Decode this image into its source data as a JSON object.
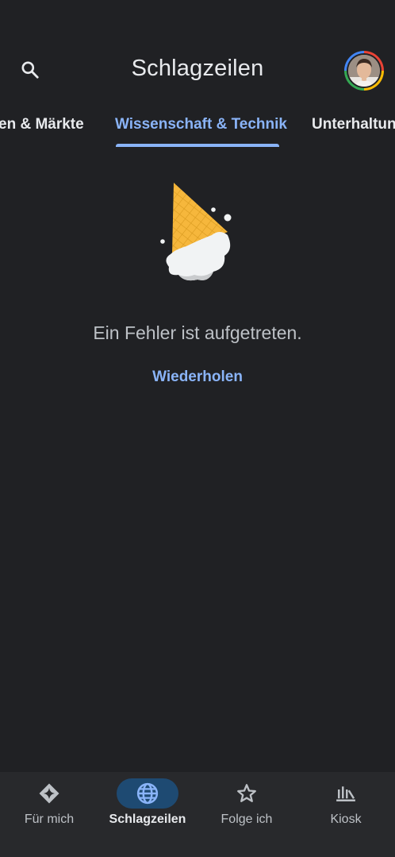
{
  "header": {
    "title": "Schlagzeilen",
    "search_icon": "search-icon",
    "avatar_icon": "profile-avatar"
  },
  "tabs": [
    {
      "label": "Wirtschaft & Märkte",
      "visible_text": "en & Märkte",
      "active": false
    },
    {
      "label": "Wissenschaft & Technik",
      "visible_text": "Wissenschaft & Technik",
      "active": true
    },
    {
      "label": "Unterhaltung",
      "visible_text": "Unterhaltun",
      "active": false
    }
  ],
  "error": {
    "illustration": "dropped-ice-cream-cone",
    "message": "Ein Fehler ist aufgetreten.",
    "retry_label": "Wiederholen"
  },
  "bottom_nav": {
    "items": [
      {
        "label": "Für mich",
        "icon": "diamond-sparkle-icon",
        "active": false
      },
      {
        "label": "Schlagzeilen",
        "icon": "globe-icon",
        "active": true
      },
      {
        "label": "Folge ich",
        "icon": "star-icon",
        "active": false
      },
      {
        "label": "Kiosk",
        "icon": "newsstand-icon",
        "active": false
      }
    ]
  },
  "colors": {
    "background": "#202124",
    "accent": "#8ab4f8",
    "nav_background": "#28292c",
    "active_pill": "#1e4a72",
    "cone": "#f6b73c"
  }
}
